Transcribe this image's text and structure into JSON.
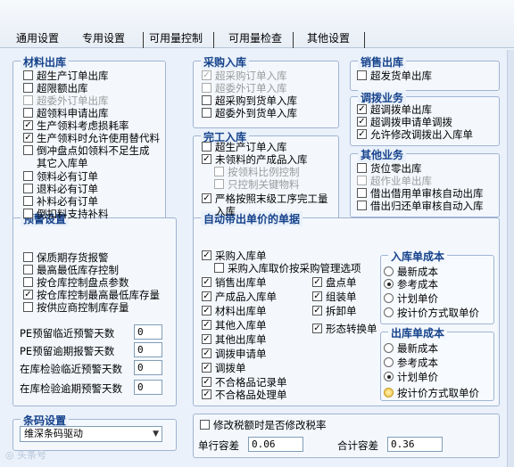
{
  "tabs": [
    {
      "label": "通用设置"
    },
    {
      "label": "专用设置"
    },
    {
      "label": "可用量控制"
    },
    {
      "label": "可用量检查"
    },
    {
      "label": "其他设置"
    }
  ],
  "material_out": {
    "title": "材料出库",
    "items": [
      {
        "label": "超生产订单出库",
        "checked": false,
        "disabled": false
      },
      {
        "label": "超限额出库",
        "checked": false,
        "disabled": false
      },
      {
        "label": "超委外订单出库",
        "checked": false,
        "disabled": true
      },
      {
        "label": "超领料申请出库",
        "checked": false,
        "disabled": false
      },
      {
        "label": "生产领料考虑损耗率",
        "checked": true,
        "disabled": false
      },
      {
        "label": "生产领料时允许使用替代料",
        "checked": true,
        "disabled": false
      },
      {
        "label": "倒冲盘点如领料不足生成其它入库单",
        "checked": false,
        "disabled": false
      },
      {
        "label": "领料必有订单",
        "checked": false,
        "disabled": false
      },
      {
        "label": "退料必有订单",
        "checked": false,
        "disabled": false
      },
      {
        "label": "补料必有订单",
        "checked": false,
        "disabled": false
      },
      {
        "label": "倒扣料支持补料",
        "checked": false,
        "disabled": false
      }
    ]
  },
  "purchase_in": {
    "title": "采购入库",
    "items": [
      {
        "label": "超采购订单入库",
        "checked": true,
        "disabled": true
      },
      {
        "label": "超委外订单入库",
        "checked": false,
        "disabled": true
      },
      {
        "label": "超采购到货单入库",
        "checked": false,
        "disabled": false
      },
      {
        "label": "超委外到货单入库",
        "checked": false,
        "disabled": false
      }
    ]
  },
  "completion_in": {
    "title": "完工入库",
    "items": [
      {
        "label": "超生产订单入库",
        "checked": false,
        "disabled": false
      },
      {
        "label": "未领料的产成品入库",
        "checked": true,
        "disabled": false
      },
      {
        "label": "按领料比例控制",
        "checked": false,
        "disabled": true
      },
      {
        "label": "只控制关键物料",
        "checked": false,
        "disabled": true
      },
      {
        "label": "严格按照末级工序完工量入库",
        "checked": true,
        "disabled": false
      }
    ]
  },
  "sales_out": {
    "title": "销售出库",
    "items": [
      {
        "label": "超发货单出库",
        "checked": false,
        "disabled": false
      }
    ]
  },
  "transfer": {
    "title": "调拨业务",
    "items": [
      {
        "label": "超调拨单出库",
        "checked": true,
        "disabled": false
      },
      {
        "label": "超调拨申请单调拨",
        "checked": true,
        "disabled": false
      },
      {
        "label": "允许修改调拨出入库单",
        "checked": true,
        "disabled": false
      }
    ]
  },
  "other_biz": {
    "title": "其他业务",
    "items": [
      {
        "label": "货位零出库",
        "checked": false,
        "disabled": false
      },
      {
        "label": "超作业单出库",
        "checked": false,
        "disabled": true
      },
      {
        "label": "借出借用单审核自动出库",
        "checked": false,
        "disabled": false
      },
      {
        "label": "借出归还单审核自动入库",
        "checked": false,
        "disabled": false
      }
    ]
  },
  "warning": {
    "title": "预警设置",
    "items": [
      {
        "label": "保质期存货报警",
        "checked": false
      },
      {
        "label": "最高最低库存控制",
        "checked": false
      },
      {
        "label": "按仓库控制盘点参数",
        "checked": false
      },
      {
        "label": "按仓库控制最高最低库存量",
        "checked": true
      },
      {
        "label": "按供应商控制库存量",
        "checked": false
      }
    ],
    "fields": [
      {
        "label": "PE预留临近预警天数",
        "value": "0"
      },
      {
        "label": "PE预留逾期报警天数",
        "value": "0"
      },
      {
        "label": "在库检验临近预警天数",
        "value": "0"
      },
      {
        "label": "在库检验逾期预警天数",
        "value": "0"
      }
    ]
  },
  "barcode": {
    "title": "条码设置",
    "selected": "维深条码驱动"
  },
  "auto_price": {
    "title": "自动带出单价的单据",
    "items": [
      {
        "label": "采购入库单",
        "checked": true
      },
      {
        "label": "采购入库取价按采购管理选项",
        "checked": false
      },
      {
        "label": "销售出库单",
        "checked": true
      },
      {
        "label": "盘点单",
        "checked": true
      },
      {
        "label": "产成品入库单",
        "checked": true
      },
      {
        "label": "组装单",
        "checked": true
      },
      {
        "label": "材料出库单",
        "checked": true
      },
      {
        "label": "拆卸单",
        "checked": true
      },
      {
        "label": "其他入库单",
        "checked": true
      },
      {
        "label": "形态转换单",
        "checked": true
      },
      {
        "label": "其他出库单",
        "checked": true
      },
      {
        "label": "调拨申请单",
        "checked": true
      },
      {
        "label": "调拨单",
        "checked": true
      },
      {
        "label": "不合格品记录单",
        "checked": true
      },
      {
        "label": "不合格品处理单",
        "checked": true
      }
    ]
  },
  "in_cost": {
    "title": "入库单成本",
    "options": [
      {
        "label": "最新成本",
        "selected": false
      },
      {
        "label": "参考成本",
        "selected": true
      },
      {
        "label": "计划单价",
        "selected": false
      },
      {
        "label": "按计价方式取单价",
        "selected": false
      }
    ]
  },
  "out_cost": {
    "title": "出库单成本",
    "options": [
      {
        "label": "最新成本",
        "selected": false
      },
      {
        "label": "参考成本",
        "selected": false
      },
      {
        "label": "计划单价",
        "selected": true
      },
      {
        "label": "按计价方式取单价",
        "selected": false,
        "highlight": true
      }
    ]
  },
  "tax": {
    "label": "修改税额时是否修改税率",
    "checked": false,
    "unit_tol_label": "单行容差",
    "unit_tol_value": "0.06",
    "total_tol_label": "合计容差",
    "total_tol_value": "0.36"
  }
}
